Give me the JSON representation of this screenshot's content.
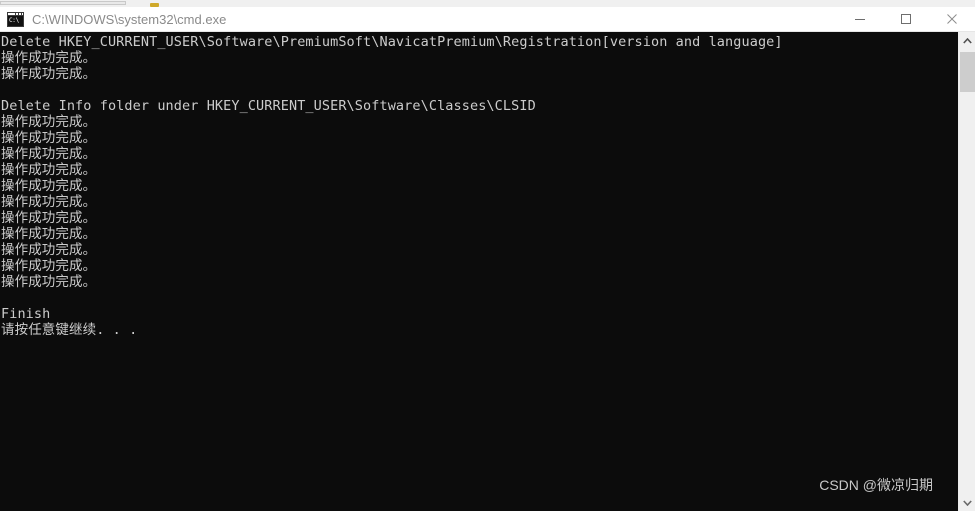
{
  "window": {
    "title": "C:\\WINDOWS\\system32\\cmd.exe",
    "icon_name": "cmd-console-icon",
    "icon_glyph": "C:\\",
    "controls": {
      "minimize_label": "Minimize",
      "maximize_label": "Maximize",
      "close_label": "Close"
    },
    "background_color": "#0c0c0c",
    "text_color": "#cccccc",
    "titlebar_text_color": "#8a8a8a"
  },
  "console": {
    "lines": [
      "Delete HKEY_CURRENT_USER\\Software\\PremiumSoft\\NavicatPremium\\Registration[version and language]",
      "操作成功完成。",
      "操作成功完成。",
      "",
      "Delete Info folder under HKEY_CURRENT_USER\\Software\\Classes\\CLSID",
      "操作成功完成。",
      "操作成功完成。",
      "操作成功完成。",
      "操作成功完成。",
      "操作成功完成。",
      "操作成功完成。",
      "操作成功完成。",
      "操作成功完成。",
      "操作成功完成。",
      "操作成功完成。",
      "操作成功完成。",
      "",
      "Finish",
      "请按任意键继续. . ."
    ]
  },
  "watermark": {
    "text": "CSDN @微凉归期"
  },
  "scrollbar": {
    "up_arrow_name": "scroll-up-arrow",
    "down_arrow_name": "scroll-down-arrow",
    "thumb_name": "scrollbar-thumb"
  }
}
